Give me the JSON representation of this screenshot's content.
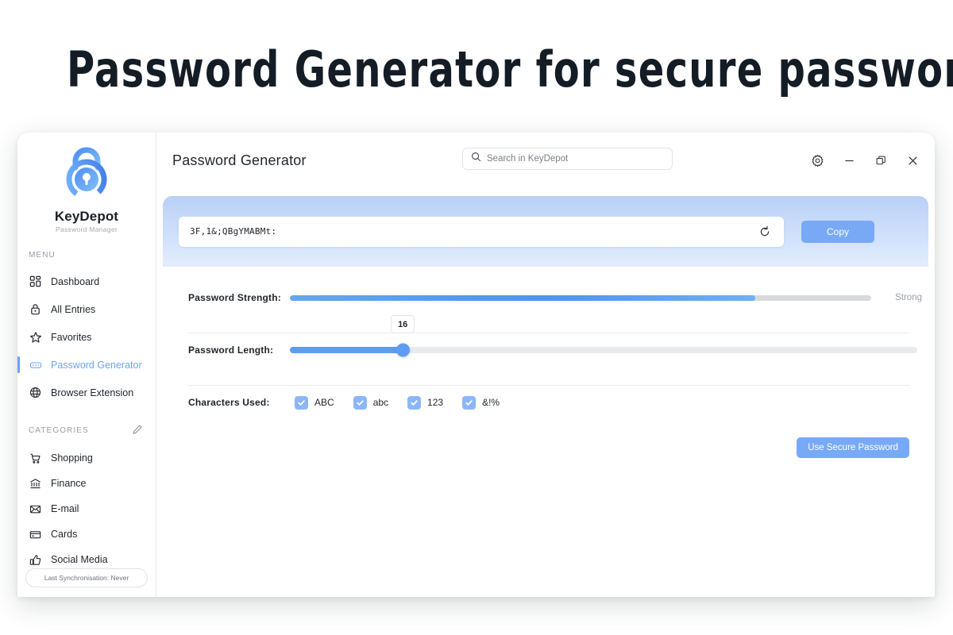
{
  "headline": "Password Generator for secure passwords",
  "brand": {
    "name": "KeyDepot",
    "tagline": "Password Manager",
    "logo_icon": "padlock-circle-icon"
  },
  "sidebar": {
    "menu_label": "MENU",
    "menu_items": [
      {
        "label": "Dashboard",
        "icon": "grid-dashboard-icon",
        "active": false
      },
      {
        "label": "All Entries",
        "icon": "lock-icon",
        "active": false
      },
      {
        "label": "Favorites",
        "icon": "star-icon",
        "active": false
      },
      {
        "label": "Password Generator",
        "icon": "password-dots-icon",
        "active": true
      },
      {
        "label": "Browser Extension",
        "icon": "globe-icon",
        "active": false
      }
    ],
    "categories_label": "CATEGORIES",
    "categories_edit_icon": "pencil-icon",
    "categories": [
      {
        "label": "Shopping",
        "icon": "shopping-cart-icon"
      },
      {
        "label": "Finance",
        "icon": "bank-icon"
      },
      {
        "label": "E-mail",
        "icon": "envelope-icon"
      },
      {
        "label": "Cards",
        "icon": "credit-card-icon"
      },
      {
        "label": "Social Media",
        "icon": "thumbs-up-icon"
      }
    ],
    "sync_status": "Last Synchronisation: Never"
  },
  "header": {
    "title": "Password Generator",
    "search": {
      "placeholder": "Search in KeyDepot",
      "value": "",
      "icon": "search-icon"
    },
    "window_controls": [
      {
        "name": "settings-button",
        "icon": "gear-icon"
      },
      {
        "name": "minimize-button",
        "icon": "minimize-icon"
      },
      {
        "name": "maximize-button",
        "icon": "restore-icon"
      },
      {
        "name": "close-button",
        "icon": "close-icon"
      }
    ]
  },
  "generator": {
    "password_value": "3F,1&;QBgYMABMt:",
    "refresh_icon": "refresh-icon",
    "copy_label": "Copy",
    "strength_label": "Password Strength:",
    "strength_value": "Strong",
    "strength_percent": 80,
    "length_label": "Password Length:",
    "length_value": "16",
    "length_percent": 18,
    "characters_label": "Characters Used:",
    "character_sets": [
      {
        "label": "ABC",
        "checked": true
      },
      {
        "label": "abc",
        "checked": true
      },
      {
        "label": "123",
        "checked": true
      },
      {
        "label": "&!%",
        "checked": true
      }
    ],
    "use_password_label": "Use Secure Password"
  },
  "colors": {
    "accent": "#77a9f7",
    "accent_strong": "#5e9cf4",
    "banner_top": "#b9d0f7",
    "text_dark": "#1f232a",
    "muted": "#9ba0a8"
  }
}
